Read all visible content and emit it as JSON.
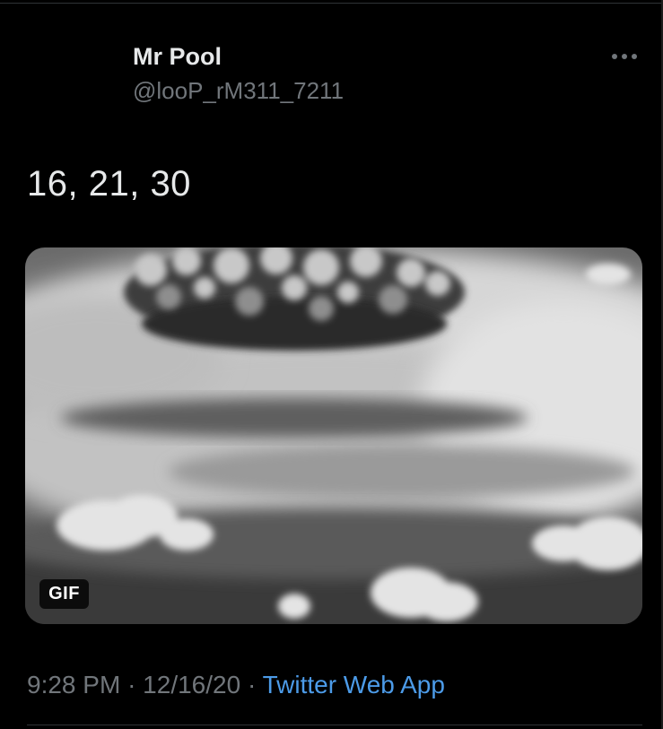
{
  "tweet": {
    "display_name": "Mr Pool",
    "handle": "@looP_rM311_7211",
    "more_icon": "more-horizontal-icon",
    "text": "16, 21, 30",
    "media": {
      "kind": "animated gif",
      "badge": "GIF"
    },
    "time": "9:28 PM",
    "separator": "·",
    "date": "12/16/20",
    "source": "Twitter Web App"
  },
  "colors": {
    "background": "#000000",
    "primary_text": "#e7e9ea",
    "secondary_text": "#71767b",
    "link": "#4c9be8",
    "divider": "#2f3336"
  }
}
